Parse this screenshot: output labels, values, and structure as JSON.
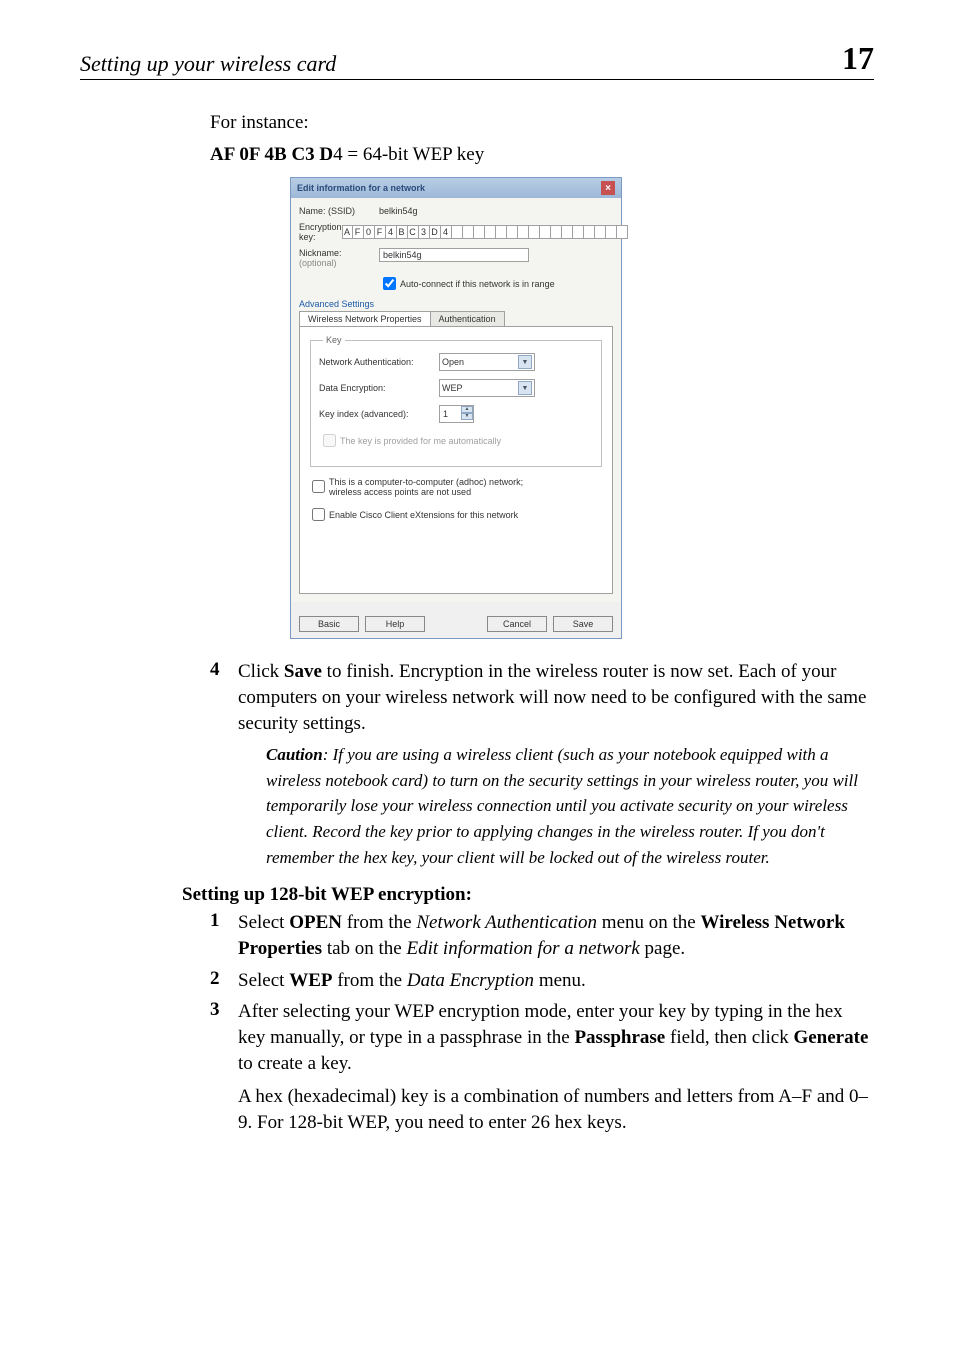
{
  "header": {
    "title": "Setting up your wireless card",
    "page_number": "17"
  },
  "intro": {
    "line1": "For instance:",
    "line2_bold": "AF 0F 4B C3 D",
    "line2_rest": "4 = 64-bit WEP key"
  },
  "dialog": {
    "title": "Edit information for a network",
    "name_label": "Name: (SSID)",
    "name_value": "belkin54g",
    "enc_label": "Encryption key:",
    "enc_cells": [
      "A",
      "F",
      "0",
      "F",
      "4",
      "B",
      "C",
      "3",
      "D",
      "4",
      "",
      "",
      "",
      "",
      "",
      "",
      "",
      "",
      "",
      "",
      "",
      "",
      "",
      "",
      "",
      ""
    ],
    "nick_label": "Nickname:",
    "nick_sub": "(optional)",
    "nick_value": "belkin54g",
    "auto_connect": "Auto-connect if this network is in range",
    "adv_link": "Advanced Settings",
    "tab1": "Wireless Network Properties",
    "tab2": "Authentication",
    "key_legend": "Key",
    "net_auth_label": "Network Authentication:",
    "net_auth_value": "Open",
    "data_enc_label": "Data Encryption:",
    "data_enc_value": "WEP",
    "key_index_label": "Key index (advanced):",
    "key_index_value": "1",
    "key_auto": "The key is provided for me automatically",
    "adhoc": "This is a computer-to-computer (adhoc) network; wireless access points are not used",
    "cisco": "Enable Cisco Client eXtensions for this network",
    "btn_basic": "Basic",
    "btn_help": "Help",
    "btn_cancel": "Cancel",
    "btn_save": "Save"
  },
  "step4": {
    "num": "4",
    "text_a": "Click ",
    "text_save": "Save",
    "text_b": " to finish. Encryption in the wireless router is now set. Each of your computers on your wireless network will now need to be configured with the same security settings."
  },
  "caution": {
    "label": "Caution",
    "text": ": If you are using a wireless client (such as your notebook equipped with a wireless notebook card) to turn on the security settings in your wireless router, you will temporarily lose your wireless connection until you activate security on your wireless client. Record the key prior to applying changes in the wireless router. If you don't remember the hex key, your client will be locked out of the wireless router."
  },
  "section128": {
    "heading": "Setting up 128-bit WEP encryption:",
    "s1": {
      "num": "1",
      "a": "Select ",
      "open": "OPEN",
      "b": " from the ",
      "na": "Network Authentication",
      "c": " menu on the ",
      "wnp": "Wireless Network Properties",
      "d": " tab on the ",
      "ei": "Edit information for a network",
      "e": " page."
    },
    "s2": {
      "num": "2",
      "a": "Select ",
      "wep": "WEP",
      "b": " from the ",
      "de": "Data Encryption",
      "c": " menu."
    },
    "s3": {
      "num": "3",
      "a": "After selecting your WEP encryption mode, enter your key by typing in the hex key manually, or type in a passphrase in the ",
      "pass": "Passphrase",
      "b": " field, then click ",
      "gen": "Generate",
      "c": " to create a key.",
      "p2": "A hex (hexadecimal) key is a combination of numbers and letters from A–F and 0–9. For 128-bit WEP, you need to enter 26 hex keys."
    }
  }
}
